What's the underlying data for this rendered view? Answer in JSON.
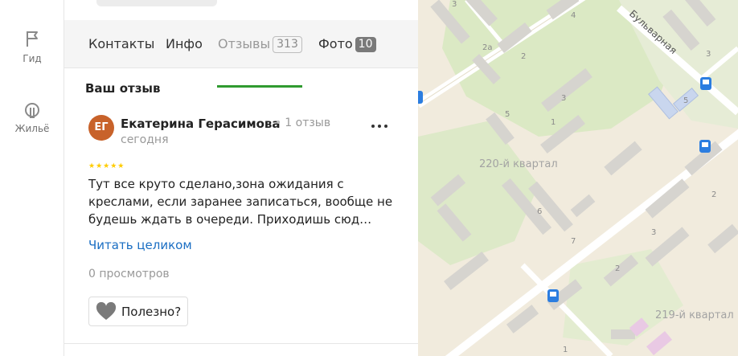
{
  "rail": {
    "guide_label": "Гид",
    "housing_label": "Жильё"
  },
  "tabs": {
    "contacts": "Контакты",
    "info": "Инфо",
    "reviews": "Отзывы",
    "reviews_count": "313",
    "photo": "Фото",
    "photo_count": "10"
  },
  "review": {
    "section_title": "Ваш отзыв",
    "avatar_initials": "ЕГ",
    "author": "Екатерина Герасимова",
    "author_reviews": "1 отзыв",
    "date": "сегодня",
    "rating": 5,
    "stars": "★★★★★",
    "text": "Тут все круто сделано,зона ожидания с креслами, если заранее записаться, вообще не будешь ждать в очереди. Приходишь сюд…",
    "read_more": "Читать целиком",
    "views": "0 просмотров",
    "useful": "Полезно?"
  },
  "map": {
    "street": "Бульварная",
    "district_1": "220-й квартал",
    "district_2": "219-й квартал",
    "house_numbers": [
      "4",
      "3",
      "2а",
      "2",
      "1",
      "3",
      "5",
      "5",
      "3",
      "6",
      "7",
      "2",
      "3",
      "2",
      "1"
    ]
  },
  "colors": {
    "accent_green": "#2f9a2f",
    "link_blue": "#1a6ec3",
    "avatar_bg": "#c8622a",
    "map_bg": "#f1ebdd",
    "map_park": "#dbe9c4",
    "map_building": "#d8d6d2",
    "bus_stop": "#2b7de0"
  }
}
